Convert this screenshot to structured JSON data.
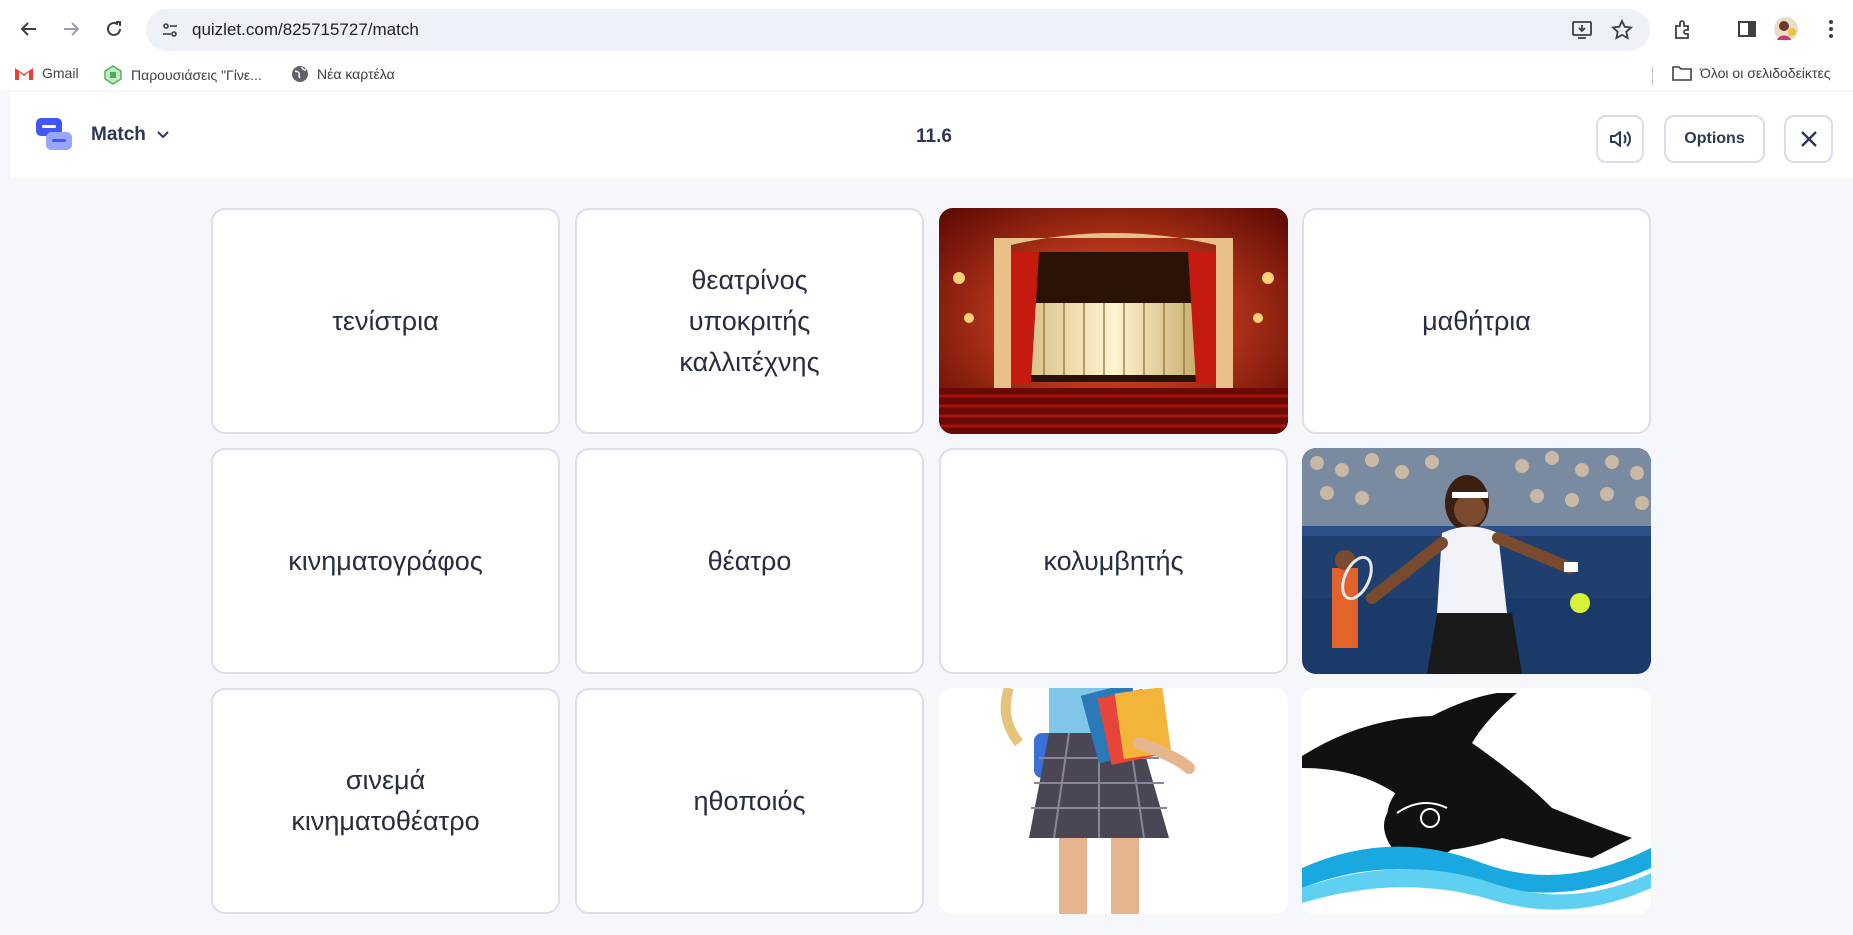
{
  "browser": {
    "url": "quizlet.com/825715727/match",
    "bookmarks": [
      {
        "label": "Gmail",
        "icon": "gmail-icon"
      },
      {
        "label": "Παρουσιάσεις \"Γίνε...",
        "icon": "slides-icon"
      },
      {
        "label": "Νέα καρτέλα",
        "icon": "globe-icon"
      }
    ],
    "all_bookmarks": "Όλοι οι σελιδοδείκτες"
  },
  "header": {
    "mode": "Match",
    "timer": "11.6",
    "options_label": "Options"
  },
  "cards": [
    {
      "text": "τενίστρια"
    },
    {
      "text": "θεατρίνος\nυποκριτής\nκαλλιτέχνης"
    },
    {
      "image": "theater-stage-image"
    },
    {
      "text": "μαθήτρια"
    },
    {
      "text": "κινηματογράφος"
    },
    {
      "text": "θέατρο"
    },
    {
      "text": "κολυμβητής"
    },
    {
      "image": "tennis-player-image"
    },
    {
      "text": "σινεμά\nκινηματοθέατρο"
    },
    {
      "text": "ηθοποιός"
    },
    {
      "image": "schoolgirl-books-image"
    },
    {
      "image": "swimmer-image"
    }
  ],
  "colors": {
    "brand": "#4255ff",
    "text": "#282e3e",
    "background": "#f6f7fb"
  }
}
